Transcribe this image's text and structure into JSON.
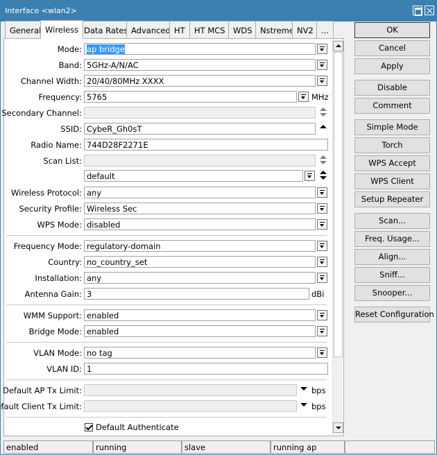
{
  "window": {
    "title": "Interface <wlan2>"
  },
  "tabs": [
    {
      "label": "General"
    },
    {
      "label": "Wireless"
    },
    {
      "label": "Data Rates"
    },
    {
      "label": "Advanced"
    },
    {
      "label": "HT"
    },
    {
      "label": "HT MCS"
    },
    {
      "label": "WDS"
    },
    {
      "label": "Nstreme"
    },
    {
      "label": "NV2"
    },
    {
      "label": "..."
    }
  ],
  "form": {
    "mode": {
      "label": "Mode:",
      "value": "ap bridge"
    },
    "band": {
      "label": "Band:",
      "value": "5GHz-A/N/AC"
    },
    "channel_width": {
      "label": "Channel Width:",
      "value": "20/40/80MHz XXXX"
    },
    "frequency": {
      "label": "Frequency:",
      "value": "5765",
      "unit": "MHz"
    },
    "secondary_channel": {
      "label": "Secondary Channel:",
      "value": ""
    },
    "ssid": {
      "label": "SSID:",
      "value": "CybeR_Gh0sT"
    },
    "radio_name": {
      "label": "Radio Name:",
      "value": "744D28F2271E"
    },
    "scan_list": {
      "label": "Scan List:",
      "value": "",
      "value2": "default"
    },
    "wireless_protocol": {
      "label": "Wireless Protocol:",
      "value": "any"
    },
    "security_profile": {
      "label": "Security Profile:",
      "value": "Wireless Sec"
    },
    "wps_mode": {
      "label": "WPS Mode:",
      "value": "disabled"
    },
    "frequency_mode": {
      "label": "Frequency Mode:",
      "value": "regulatory-domain"
    },
    "country": {
      "label": "Country:",
      "value": "no_country_set"
    },
    "installation": {
      "label": "Installation:",
      "value": "any"
    },
    "antenna_gain": {
      "label": "Antenna Gain:",
      "value": "3",
      "unit": "dBi"
    },
    "wmm_support": {
      "label": "WMM Support:",
      "value": "enabled"
    },
    "bridge_mode": {
      "label": "Bridge Mode:",
      "value": "enabled"
    },
    "vlan_mode": {
      "label": "VLAN Mode:",
      "value": "no tag"
    },
    "vlan_id": {
      "label": "VLAN ID:",
      "value": "1"
    },
    "default_ap_tx_limit": {
      "label": "Default AP Tx Limit:",
      "value": "",
      "unit": "bps"
    },
    "default_client_tx_limit": {
      "label": "Default Client Tx Limit:",
      "value": "",
      "unit": "bps"
    },
    "default_authenticate": {
      "label": "Default Authenticate",
      "checked": true
    }
  },
  "buttons": {
    "ok": "OK",
    "cancel": "Cancel",
    "apply": "Apply",
    "disable": "Disable",
    "comment": "Comment",
    "simple_mode": "Simple Mode",
    "torch": "Torch",
    "wps_accept": "WPS Accept",
    "wps_client": "WPS Client",
    "setup_repeater": "Setup Repeater",
    "scan": "Scan...",
    "freq_usage": "Freq. Usage...",
    "align": "Align...",
    "sniff": "Sniff...",
    "snooper": "Snooper...",
    "reset_configuration": "Reset Configuration"
  },
  "status": [
    "enabled",
    "running",
    "slave",
    "running ap",
    ""
  ],
  "colors": {
    "titlebar": "#3c7fb1",
    "selection": "#3399ff"
  }
}
